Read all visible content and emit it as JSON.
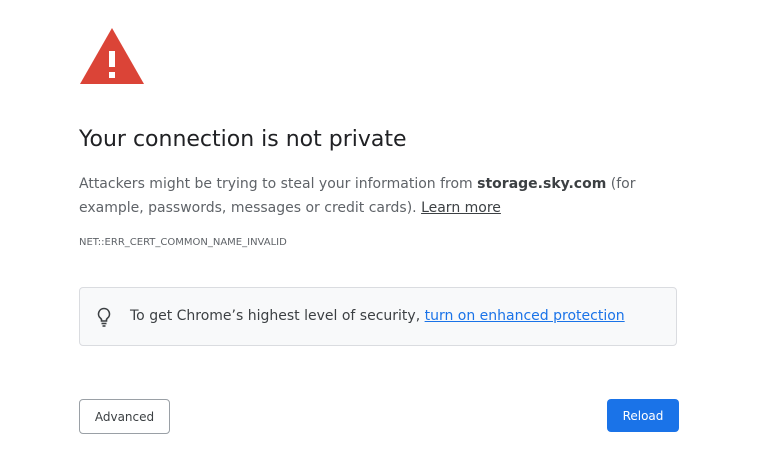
{
  "colors": {
    "warning_red": "#db4437",
    "link_blue": "#1a73e8",
    "button_primary": "#1a73e8"
  },
  "icons": {
    "warning": "warning-triangle-icon",
    "tip": "lightbulb-icon"
  },
  "interstitial": {
    "title": "Your connection is not private",
    "explanation": {
      "prefix": "Attackers might be trying to steal your information from ",
      "host": "storage.sky.com",
      "suffix": " (for example, passwords, messages or credit cards). ",
      "learn_more": "Learn more"
    },
    "error_code": "NET::ERR_CERT_COMMON_NAME_INVALID"
  },
  "promo": {
    "text": "To get Chrome’s highest level of security, ",
    "link": "turn on enhanced protection"
  },
  "buttons": {
    "advanced": "Advanced",
    "reload": "Reload"
  }
}
